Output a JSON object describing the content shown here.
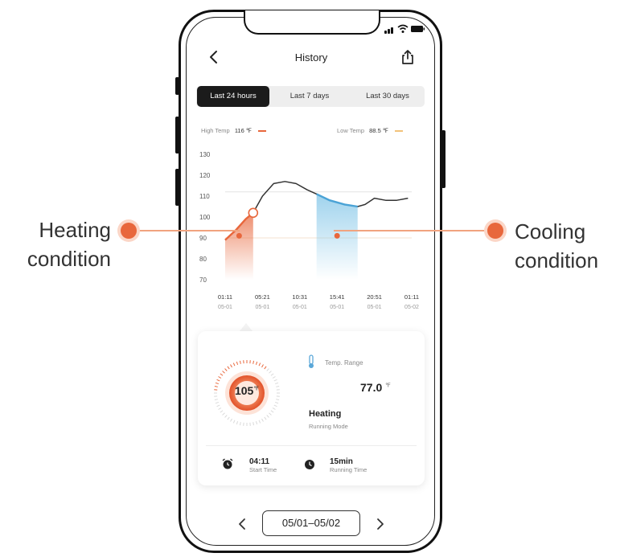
{
  "header": {
    "title": "History"
  },
  "tabs": [
    {
      "label": "Last 24 hours",
      "active": true
    },
    {
      "label": "Last 7 days",
      "active": false
    },
    {
      "label": "Last 30 days",
      "active": false
    }
  ],
  "legend": {
    "high_label": "High Temp",
    "high_value": "116 ℉",
    "low_label": "Low Temp",
    "low_value": "88.5 ℉",
    "high_color": "#e8673c",
    "low_color": "#f2c27a"
  },
  "chart_data": {
    "type": "line",
    "ylim": [
      70,
      130
    ],
    "y_ticks": [
      "130",
      "120",
      "110",
      "100",
      "90",
      "80",
      "70"
    ],
    "x_ticks": [
      {
        "time": "01:11",
        "date": "05-01"
      },
      {
        "time": "05:21",
        "date": "05-01"
      },
      {
        "time": "10:31",
        "date": "05-01"
      },
      {
        "time": "15:41",
        "date": "05-01"
      },
      {
        "time": "20:51",
        "date": "05-01"
      },
      {
        "time": "01:11",
        "date": "05-02"
      }
    ],
    "series": [
      {
        "values": [
          [
            0,
            89
          ],
          [
            0.3,
            94
          ],
          [
            0.55,
            99
          ],
          [
            0.75,
            102
          ],
          [
            1.0,
            110
          ],
          [
            1.3,
            116
          ],
          [
            1.6,
            117
          ],
          [
            1.9,
            116
          ],
          [
            2.2,
            113
          ],
          [
            2.45,
            111
          ],
          [
            2.8,
            108
          ],
          [
            3.2,
            106
          ],
          [
            3.55,
            105
          ],
          [
            3.75,
            106
          ],
          [
            4.0,
            109
          ],
          [
            4.3,
            108
          ],
          [
            4.6,
            108
          ],
          [
            4.9,
            109
          ]
        ]
      }
    ],
    "reference_lines": {
      "high": 112,
      "low": 90
    },
    "heating_region": [
      0,
      0.75
    ],
    "cooling_region": [
      2.45,
      3.55
    ],
    "heating_color": "#e8673c",
    "cooling_color": "#8ecbea"
  },
  "card": {
    "dial_value": "105",
    "dial_unit": "℉",
    "range_label": "Temp. Range",
    "range_value": "77.0",
    "range_unit": "℉",
    "mode_value": "Heating",
    "mode_label": "Running Mode",
    "start_time_value": "04:11",
    "start_time_label": "Start Time",
    "running_time_value": "15min",
    "running_time_label": "Running Time"
  },
  "date_range": "05/01–05/02",
  "callouts": {
    "heating": "Heating condition",
    "heating_line1": "Heating",
    "heating_line2": "condition",
    "cooling_line1": "Cooling",
    "cooling_line2": "condition",
    "accent": "#e8673c"
  },
  "icons": {
    "back": "chevron-left-icon",
    "share": "share-icon",
    "thermometer": "thermometer-icon",
    "alarm": "alarm-clock-icon",
    "clock": "clock-icon"
  }
}
